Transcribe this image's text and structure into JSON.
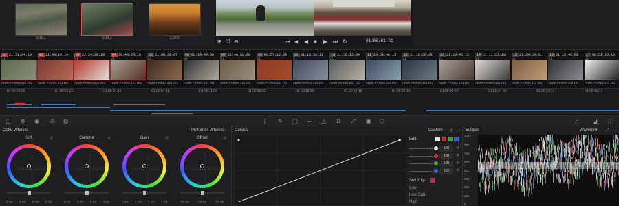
{
  "gallery": {
    "stills": [
      {
        "label": "2.18.1",
        "selected": false
      },
      {
        "label": "2.21.1",
        "selected": true
      },
      {
        "label": "2.24.1",
        "selected": false
      }
    ]
  },
  "viewer": {
    "timecode": "01:00:01:21",
    "transport_icons": [
      "skip-to-start-icon",
      "step-back-icon",
      "play-reverse-icon",
      "stop-icon",
      "play-icon",
      "step-forward-icon",
      "loop-icon"
    ]
  },
  "clips": [
    {
      "num": "01",
      "tc": "21:31:34:10",
      "track": "V1",
      "codec": "Apple ProRes 422 HQ",
      "highlight": true,
      "colors": [
        "#5c6d4e",
        "#8a8d7c"
      ]
    },
    {
      "num": "02",
      "tc": "21:40:10:14",
      "track": "V1",
      "codec": "Apple ProRes 422 HQ",
      "highlight": true,
      "colors": [
        "#7a3a32",
        "#b86a55"
      ]
    },
    {
      "num": "03",
      "tc": "22:24:38:18",
      "track": "V1",
      "codec": "Apple ProRes 422 HQ",
      "highlight": true,
      "colors": [
        "#b53a2f",
        "#e3e0d8"
      ]
    },
    {
      "num": "04",
      "tc": "20:49:23:18",
      "track": "V1",
      "codec": "Apple ProRes 422 HQ",
      "highlight": true,
      "colors": [
        "#a7a195",
        "#5a3026"
      ]
    },
    {
      "num": "05",
      "tc": "21:08:39:07",
      "track": "V1",
      "codec": "Apple ProRes 422 HQ",
      "highlight": false,
      "colors": [
        "#3c2a22",
        "#8f6a4c"
      ]
    },
    {
      "num": "06",
      "tc": "06:39:49:06",
      "track": "V1",
      "codec": "Apple ProRes 422 HQ",
      "highlight": false,
      "colors": [
        "#2f3238",
        "#b0a896"
      ]
    },
    {
      "num": "07",
      "tc": "21:46:53:00",
      "track": "V1",
      "codec": "Apple ProRes 422 HQ",
      "highlight": false,
      "colors": [
        "#6d5a45",
        "#9a9184"
      ]
    },
    {
      "num": "08",
      "tc": "06:57:12:03",
      "track": "V1",
      "codec": "Apple ProRes 422 HQ",
      "highlight": false,
      "colors": [
        "#8b3b24",
        "#a74b2b"
      ]
    },
    {
      "num": "09",
      "tc": "01:10:59:11",
      "track": "V1",
      "codec": "Apple ProRes 422 HQ",
      "highlight": false,
      "colors": [
        "#404a58",
        "#8690a0"
      ]
    },
    {
      "num": "10",
      "tc": "21:36:22:04",
      "track": "V1",
      "codec": "Apple ProRes 422 HQ",
      "highlight": false,
      "colors": [
        "#5a5a5d",
        "#b8b2a6"
      ]
    },
    {
      "num": "11",
      "tc": "20:58:46:13",
      "track": "V1",
      "codec": "Apple ProRes 422 HQ",
      "highlight": false,
      "colors": [
        "#3b4b5c",
        "#8aa0b0"
      ]
    },
    {
      "num": "12",
      "tc": "21:10:58:01",
      "track": "V1",
      "codec": "Apple ProRes 422 HQ",
      "highlight": false,
      "colors": [
        "#26343e",
        "#6e7d84"
      ]
    },
    {
      "num": "13",
      "tc": "21:59:45:15",
      "track": "V1",
      "codec": "Apple ProRes 422 HQ",
      "highlight": false,
      "colors": [
        "#aaa19a",
        "#4a3c33"
      ]
    },
    {
      "num": "14",
      "tc": "21:11:53:18",
      "track": "V1",
      "codec": "Apple ProRes 422 HQ",
      "highlight": false,
      "colors": [
        "#dedbd5",
        "#3a3a3a"
      ]
    },
    {
      "num": "15",
      "tc": "21:34:59:01",
      "track": "V1",
      "codec": "Apple ProRes 422 HQ",
      "highlight": false,
      "colors": [
        "#7a5c46",
        "#c49c74"
      ]
    },
    {
      "num": "16",
      "tc": "21:15:49:08",
      "track": "V1",
      "codec": "Apple ProRes 422 HQ",
      "highlight": false,
      "colors": [
        "#2d3033",
        "#8c8f90"
      ]
    },
    {
      "num": "17",
      "tc": "00:52:20:18",
      "track": "V1",
      "codec": "Apple ProRes 422 HQ",
      "highlight": false,
      "colors": [
        "#f0efec",
        "#232323"
      ]
    }
  ],
  "ruler": [
    "01:00:00:00",
    "01:00:01:21",
    "01:00:04:16",
    "01:00:07:11",
    "01:00:11:06",
    "01:00:15:01",
    "01:00:18:20",
    "01:00:22:15",
    "01:00:26:10",
    "01:00:30:05",
    "01:00:34:00",
    "01:00:37:19",
    "01:00:41:14"
  ],
  "color_wheels": {
    "title": "Color Wheels",
    "mode": "Primaries Wheels",
    "wheels": [
      {
        "label": "Lift",
        "values": [
          "0.00",
          "0.00",
          "0.00",
          "0.00"
        ]
      },
      {
        "label": "Gamma",
        "values": [
          "0.00",
          "0.00",
          "0.00",
          "0.00"
        ]
      },
      {
        "label": "Gain",
        "values": [
          "1.00",
          "1.00",
          "1.00",
          "1.00"
        ]
      },
      {
        "label": "Offset",
        "values": [
          "25.00",
          "25.00",
          "25.00"
        ]
      }
    ]
  },
  "curves": {
    "title": "Curves",
    "mode": "Custom",
    "edit_label": "Edit",
    "channels": [
      {
        "name": "Y",
        "color": "#e8e8e8",
        "value": "100"
      },
      {
        "name": "R",
        "color": "#d23a3a",
        "value": "100"
      },
      {
        "name": "G",
        "color": "#3ab84a",
        "value": "100"
      },
      {
        "name": "B",
        "color": "#3a6ed6",
        "value": "100"
      }
    ],
    "soft_clip": {
      "label": "Soft Clip",
      "rows": [
        "Low",
        "Low Soft",
        "High"
      ]
    }
  },
  "scopes": {
    "title": "Scopes",
    "mode": "Waveform",
    "axis": [
      "1023",
      "896",
      "768",
      "640",
      "512",
      "384",
      "256",
      "128",
      "0"
    ]
  }
}
